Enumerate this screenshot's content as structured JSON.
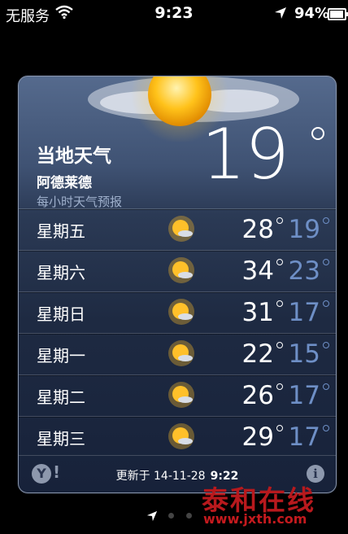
{
  "status_bar": {
    "carrier": "无服务",
    "time": "9:23",
    "battery": "94%",
    "battery_level": 0.94
  },
  "weather": {
    "title": "当地天气",
    "city": "阿德莱德",
    "subtitle": "每小时天气预报",
    "current_temp": "19",
    "forecast": [
      {
        "day": "星期五",
        "high": "28",
        "low": "19",
        "icon": "sunny-icon"
      },
      {
        "day": "星期六",
        "high": "34",
        "low": "23",
        "icon": "sunny-icon"
      },
      {
        "day": "星期日",
        "high": "31",
        "low": "17",
        "icon": "sunny-icon"
      },
      {
        "day": "星期一",
        "high": "22",
        "low": "15",
        "icon": "sunny-icon"
      },
      {
        "day": "星期二",
        "high": "26",
        "low": "17",
        "icon": "sunny-icon"
      },
      {
        "day": "星期三",
        "high": "29",
        "low": "17",
        "icon": "sunny-icon"
      }
    ],
    "footer": {
      "updated_label": "更新于 14-11-28",
      "updated_time": "9:22"
    }
  },
  "watermark": {
    "text_cn": "泰和在线",
    "url": "www.jxth.com"
  },
  "colors": {
    "low_temp": "#6e8fc6",
    "card_top": "#556a8d",
    "card_bottom": "#17223a"
  }
}
